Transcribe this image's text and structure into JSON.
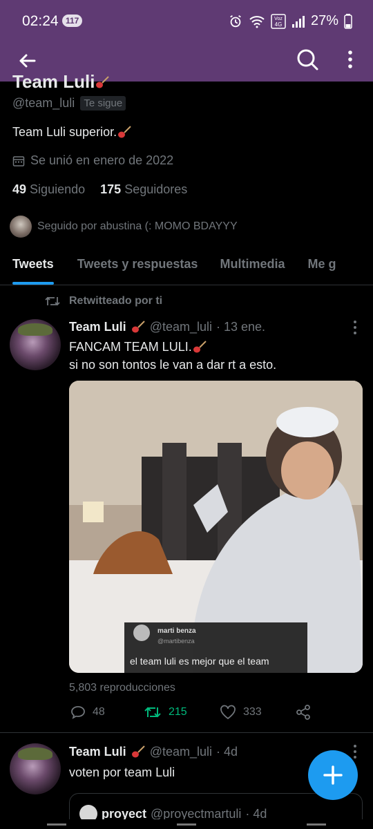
{
  "status_bar": {
    "time": "02:24",
    "notif_count": "117",
    "battery": "27%"
  },
  "profile": {
    "name": "Team Luli",
    "handle": "@team_luli",
    "follows_you": "Te sigue",
    "bio": "Team Luli superior.",
    "joined": "Se unió en enero de 2022",
    "following_count": "49",
    "following_label": "Siguiendo",
    "followers_count": "175",
    "followers_label": "Seguidores",
    "followed_by": "Seguido por abustina (: MOMO BDAYYY"
  },
  "tabs": [
    {
      "label": "Tweets",
      "active": true
    },
    {
      "label": "Tweets y respuestas",
      "active": false
    },
    {
      "label": "Multimedia",
      "active": false
    },
    {
      "label": "Me g",
      "active": false
    }
  ],
  "tweet1": {
    "retweeted_by": "Retwitteado por ti",
    "name": "Team Luli",
    "handle": "@team_luli",
    "date": "· 13 ene.",
    "line1": "FANCAM TEAM LULI.",
    "line2": "si no son tontos le van a dar rt a esto.",
    "overlay_name": "marti benza",
    "overlay_handle": "@martibenza",
    "overlay_text": "el team luli es mejor que el team",
    "views": "5,803 reproducciones",
    "replies": "48",
    "retweets": "215",
    "likes": "333"
  },
  "tweet2": {
    "name": "Team Luli",
    "handle": "@team_luli",
    "date": "· 4d",
    "text": "voten por team Luli",
    "quote_name": "proyect",
    "quote_handle": "@proyectmartuli",
    "quote_date": "· 4d"
  },
  "colors": {
    "app_bar": "#5f3a73",
    "accent": "#1d9bf0",
    "retweet_green": "#00ba7c"
  }
}
